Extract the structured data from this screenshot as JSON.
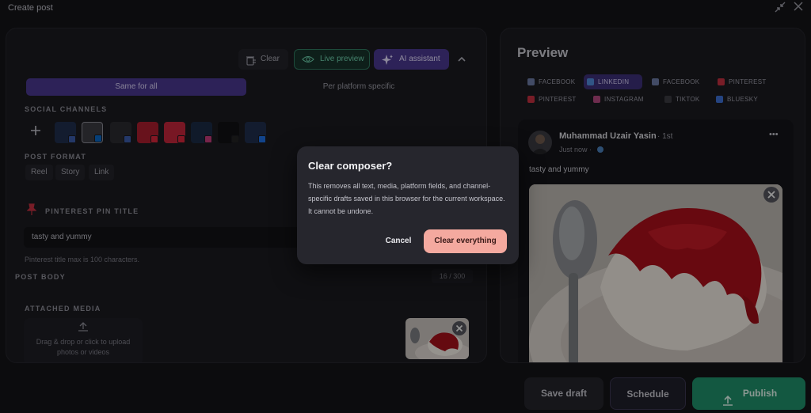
{
  "window": {
    "title": "Create post"
  },
  "toolbar": {
    "clear_label": "Clear",
    "live_preview_label": "Live preview",
    "ai_label": "AI assistant"
  },
  "mode": {
    "same_label": "Same for all",
    "specific_label": "Per platform specific"
  },
  "sections": {
    "social_channels": "SOCIAL CHANNELS",
    "post_format": "POST FORMAT",
    "pinterest_title": "PINTEREST PIN TITLE",
    "post_body": "POST BODY",
    "attached_media": "ATTACHED MEDIA"
  },
  "formats": [
    "Reel",
    "Story",
    "Link"
  ],
  "pin_title": {
    "value": "tasty and yummy",
    "note": "Pinterest title max is 100 characters."
  },
  "body": {
    "counter": "16 / 300"
  },
  "media": {
    "drop_line1": "Drag & drop or click to upload",
    "drop_line2": "photos or videos"
  },
  "preview": {
    "title": "Preview",
    "tabs_row1": [
      "FACEBOOK",
      "LINKEDIN",
      "FACEBOOK",
      "PINTEREST"
    ],
    "tabs_row2": [
      "PINTEREST",
      "INSTAGRAM",
      "TIKTOK",
      "BLUESKY"
    ],
    "author": "Muhammad Uzair Yasin",
    "degree": "· 1st",
    "time": "Just now ·",
    "text": "tasty and yummy",
    "more_glyph": "•••"
  },
  "actions": {
    "save_draft": "Save draft",
    "schedule": "Schedule",
    "publish": "Publish"
  },
  "dialog": {
    "title": "Clear composer?",
    "body": "This removes all text, media, platform fields, and channel-specific drafts saved in this browser for the current workspace. It cannot be undone.",
    "cancel": "Cancel",
    "confirm": "Clear everything"
  },
  "colors": {
    "accent": "#5b3fa8",
    "publish": "#1f8f6a",
    "danger": "#f4a99f",
    "linkedin": "#0a66c2",
    "pinterest": "#d6263b"
  }
}
